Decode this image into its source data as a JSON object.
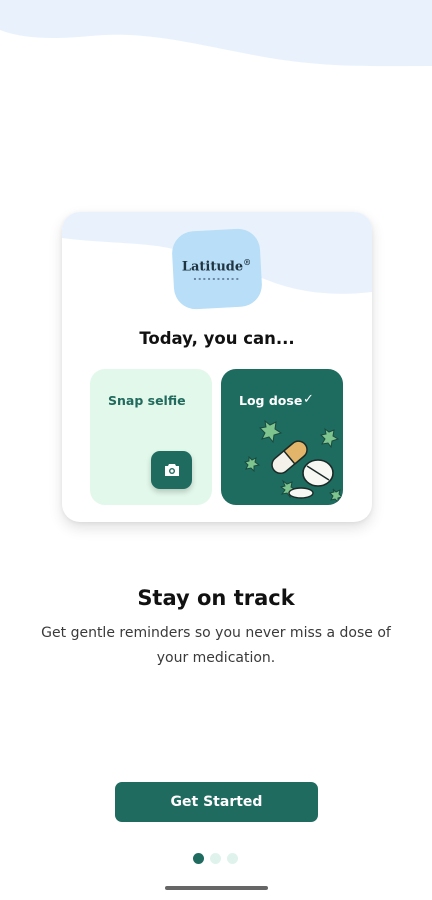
{
  "colors": {
    "brand": "#1f6b60",
    "wave": "#e9f2fc",
    "logo_bg": "#b9def8",
    "selfie_tile_bg": "#e2f8ea",
    "dot_inactive": "#dff3ec"
  },
  "card": {
    "logo": {
      "text": "Latitude",
      "reg_mark": "®"
    },
    "heading": "Today, you can...",
    "tiles": [
      {
        "label": "Snap selfie",
        "icon": "camera-icon"
      },
      {
        "label": "Log dose",
        "icon": "checkmark-icon",
        "check": "✓"
      }
    ]
  },
  "onboarding": {
    "title": "Stay on track",
    "description": "Get gentle reminders so you never miss a dose of your medication."
  },
  "cta": {
    "label": "Get Started"
  },
  "pagination": {
    "total": 3,
    "active_index": 0
  }
}
